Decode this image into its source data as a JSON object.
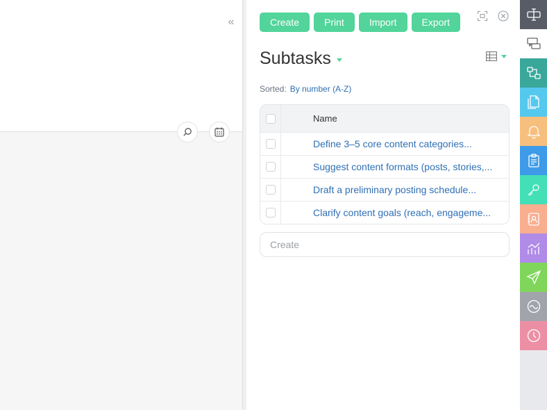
{
  "collapse_glyph": "«",
  "toolbar": {
    "buttons": [
      "Create",
      "Print",
      "Import",
      "Export"
    ]
  },
  "panel": {
    "title": "Subtasks",
    "sorted_label": "Sorted:",
    "sorted_value": "By number (A-Z)"
  },
  "table": {
    "header_name": "Name",
    "rows": [
      "Define 3–5 core content categories...",
      "Suggest content formats (posts, stories,...",
      "Draft a preliminary posting schedule...",
      "Clarify content goals (reach, engageme..."
    ]
  },
  "create_field": {
    "placeholder": "Create"
  },
  "rightbar": [
    {
      "icon": "cursor-text-icon",
      "color": "#575c66"
    },
    {
      "icon": "comments-icon",
      "color": "#ffffff"
    },
    {
      "icon": "hierarchy-icon",
      "color": "#39a89a"
    },
    {
      "icon": "document-icon",
      "color": "#55c8ee"
    },
    {
      "icon": "bell-icon",
      "color": "#f7bf7d"
    },
    {
      "icon": "clipboard-icon",
      "color": "#3d9be9"
    },
    {
      "icon": "key-icon",
      "color": "#43dfb7"
    },
    {
      "icon": "contact-icon",
      "color": "#f8ae8f"
    },
    {
      "icon": "chart-icon",
      "color": "#b08be8"
    },
    {
      "icon": "send-icon",
      "color": "#80d65a"
    },
    {
      "icon": "wave-icon",
      "color": "#a1a4ab"
    },
    {
      "icon": "clock-icon",
      "color": "#ec8fa5"
    }
  ],
  "colors": {
    "accent": "#52d49a",
    "link": "#2f6fb5"
  }
}
